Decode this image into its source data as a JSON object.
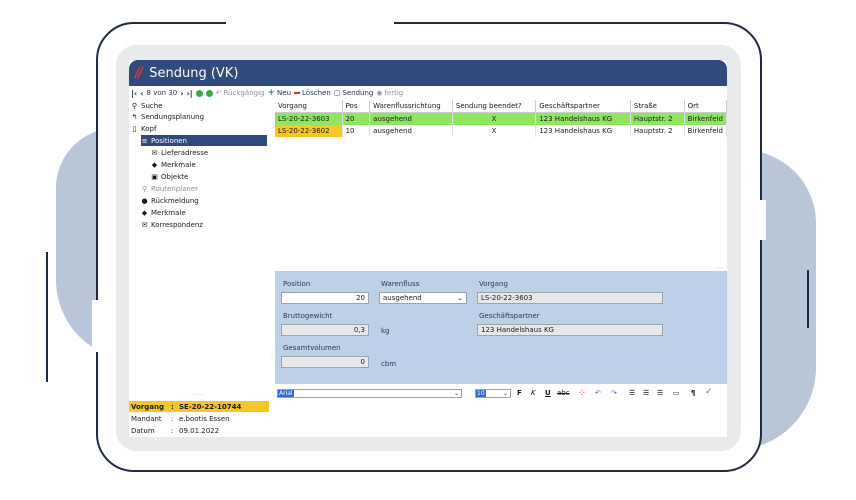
{
  "window": {
    "title": "Sendung  (VK)"
  },
  "toolbar": {
    "position": "8 von 30",
    "undo": "Rückgängig",
    "new": "Neu",
    "delete": "Löschen",
    "shipment": "Sendung",
    "done": "fertig"
  },
  "sidebar": {
    "items": [
      {
        "label": "Suche"
      },
      {
        "label": "Sendungsplanung"
      },
      {
        "label": "Kopf"
      },
      {
        "label": "Positionen"
      },
      {
        "label": "Lieferadresse"
      },
      {
        "label": "Merkmale"
      },
      {
        "label": "Objekte"
      },
      {
        "label": "Routenplaner"
      },
      {
        "label": "Rückmeldung"
      },
      {
        "label": "Merkmale"
      },
      {
        "label": "Korrespondenz"
      }
    ],
    "info": [
      {
        "key": "Vorgang",
        "value": "SE-20-22-10744"
      },
      {
        "key": "Mandant",
        "value": "e.bootis Essen"
      },
      {
        "key": "Datum",
        "value": "09.01.2022"
      }
    ]
  },
  "grid": {
    "columns": [
      "Vorgang",
      "Pos",
      "Warenflussrichtung",
      "Sendung beendet?",
      "Geschäftspartner",
      "Straße",
      "Ort"
    ],
    "rows": [
      [
        "LS-20-22-3603",
        "20",
        "ausgehend",
        "X",
        "123 Handelshaus KG",
        "Hauptstr. 2",
        "Birkenfeld"
      ],
      [
        "LS-20-22-3602",
        "10",
        "ausgehend",
        "X",
        "123 Handelshaus KG",
        "Hauptstr. 2",
        "Birkenfeld"
      ]
    ]
  },
  "form": {
    "position_label": "Position",
    "position_value": "20",
    "warenfluss_label": "Warenfluss",
    "warenfluss_value": "ausgehend",
    "vorgang_label": "Vorgang",
    "vorgang_value": "LS-20-22-3603",
    "brutto_label": "Bruttogewicht",
    "brutto_value": "0,3",
    "brutto_unit": "kg",
    "partner_label": "Geschäftspartner",
    "partner_value": "123 Handelshaus KG",
    "volumen_label": "Gesamtvolumen",
    "volumen_value": "0",
    "volumen_unit": "cbm"
  },
  "editor": {
    "font": "Arial",
    "size": "10",
    "bold": "F",
    "italic": "K",
    "underline": "U",
    "strike": "abc",
    "paragraph": "¶"
  },
  "colors": {
    "titlebar": "#2f4a7c",
    "selected_row": "#8ee65f",
    "highlight_yellow": "#f7c524",
    "form_bg": "#bdd0e8"
  }
}
